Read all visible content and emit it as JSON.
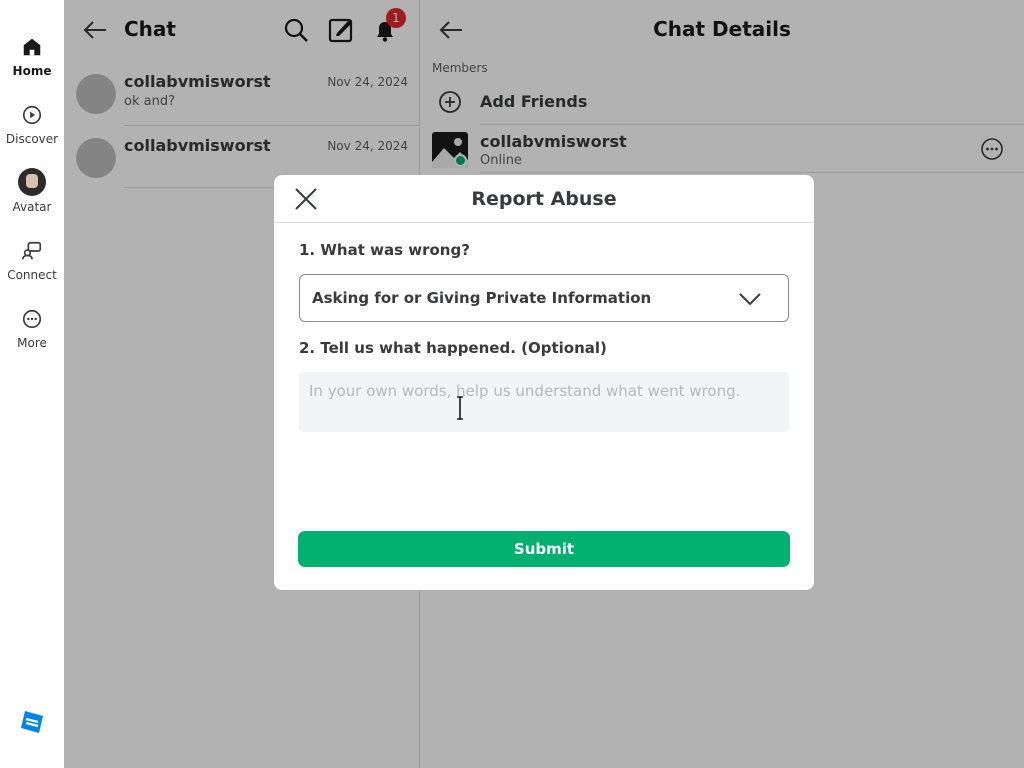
{
  "nav": {
    "items": [
      {
        "label": "Home",
        "icon": "home-icon"
      },
      {
        "label": "Discover",
        "icon": "discover-icon"
      },
      {
        "label": "Avatar",
        "icon": "avatar-icon"
      },
      {
        "label": "Connect",
        "icon": "connect-icon"
      },
      {
        "label": "More",
        "icon": "more-icon"
      }
    ],
    "active": "Home",
    "logo_icon": "roblox-logo-icon"
  },
  "chat": {
    "title": "Chat",
    "notification_count": "1",
    "conversations": [
      {
        "name": "collabvmisworst",
        "message": "ok and?",
        "date": "Nov 24, 2024"
      },
      {
        "name": "collabvmisworst",
        "message": "",
        "date": "Nov 24, 2024"
      }
    ]
  },
  "details": {
    "title": "Chat Details",
    "members_label": "Members",
    "add_friends_label": "Add Friends",
    "member": {
      "name": "collabvmisworst",
      "status": "Online"
    }
  },
  "report": {
    "title": "Report Abuse",
    "q1_label": "1. What was wrong?",
    "selected_reason": "Asking for or Giving Private Information",
    "q2_label": "2. Tell us what happened. (Optional)",
    "description_value": "",
    "description_placeholder": "In your own words, help us understand what went wrong.",
    "submit_label": "Submit"
  },
  "colors": {
    "accent_green": "#00b06f",
    "badge_red": "#e3272b",
    "logo_blue": "#0083e6"
  }
}
